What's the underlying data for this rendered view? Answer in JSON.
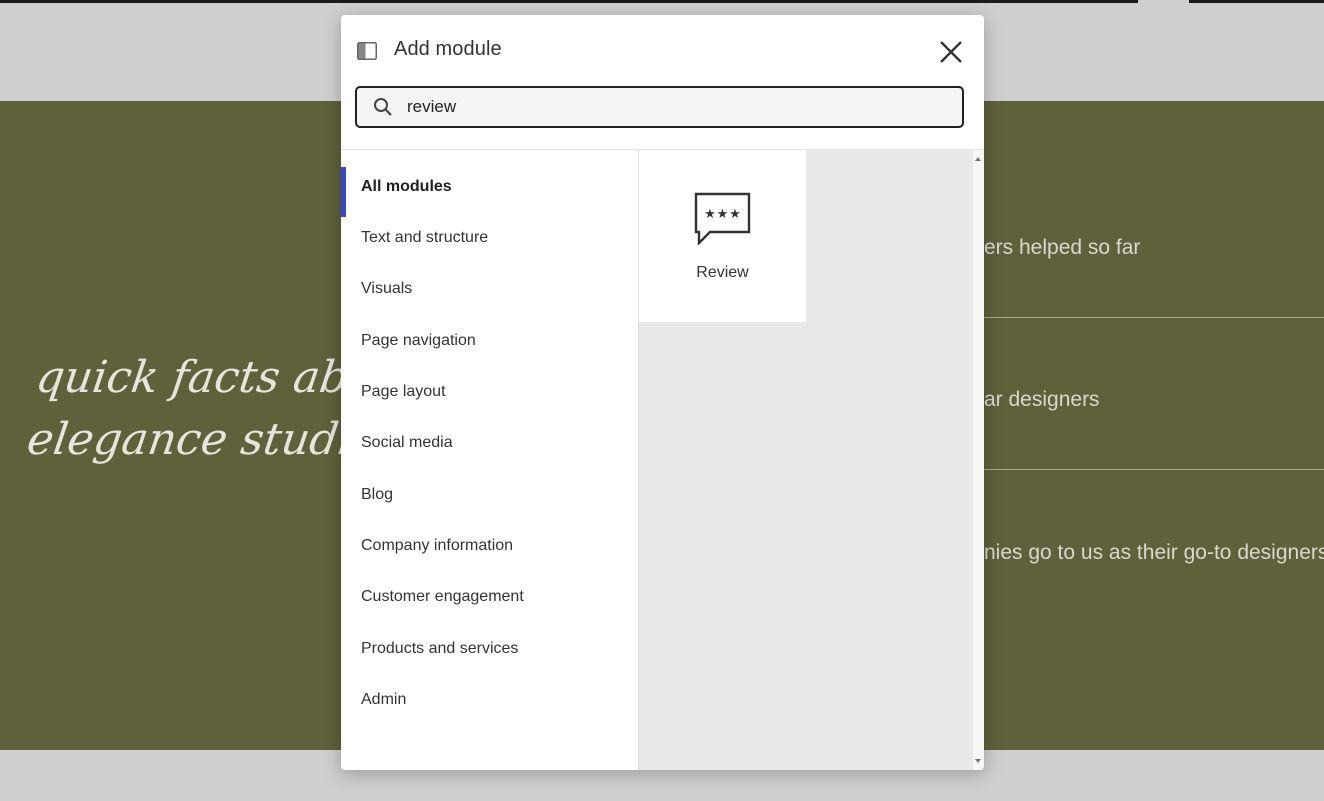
{
  "background_page": {
    "hero_title": "quick facts about us\nelegance studio",
    "facts": [
      "ers helped so far",
      "ar designers",
      "nies go to us as their go-to designers"
    ],
    "colors": {
      "hero_bg": "#5f613a",
      "page_bg": "#cfcfcf"
    }
  },
  "modal": {
    "title": "Add module",
    "panel_icon": "panel-layout-icon",
    "close_icon": "close-icon",
    "search": {
      "value": "review",
      "icon": "search-icon"
    },
    "categories": [
      {
        "label": "All modules",
        "active": true
      },
      {
        "label": "Text and structure"
      },
      {
        "label": "Visuals"
      },
      {
        "label": "Page navigation"
      },
      {
        "label": "Page layout"
      },
      {
        "label": "Social media"
      },
      {
        "label": "Blog"
      },
      {
        "label": "Company information"
      },
      {
        "label": "Customer engagement"
      },
      {
        "label": "Products and services"
      },
      {
        "label": "Admin"
      }
    ],
    "results": [
      {
        "label": "Review",
        "icon": "review-stars-icon"
      }
    ],
    "accent_color": "#3b47c9"
  }
}
